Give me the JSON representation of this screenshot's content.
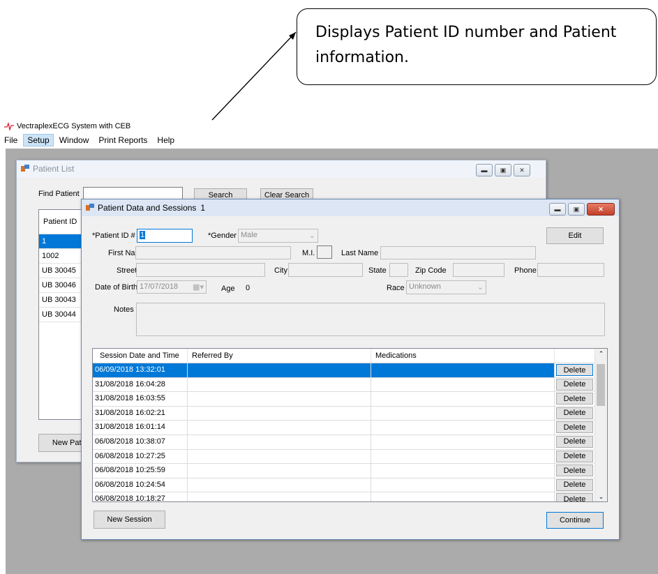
{
  "callout": {
    "text": "Displays Patient ID number and Patient information."
  },
  "app": {
    "title": "VectraplexECG System with CEB"
  },
  "menu": [
    {
      "label": "File"
    },
    {
      "label": "Setup"
    },
    {
      "label": "Window"
    },
    {
      "label": "Print Reports"
    },
    {
      "label": "Help"
    }
  ],
  "patient_list": {
    "title": "Patient List",
    "find_label": "Find Patient",
    "find_value": "",
    "search_label": "Search",
    "clear_label": "Clear Search",
    "column_header": "Patient ID",
    "rows": [
      "1",
      "1002",
      "UB 30045",
      "UB 30046",
      "UB 30043",
      "UB 30044"
    ],
    "new_patient_label": "New Patie"
  },
  "patient_window": {
    "title": "Patient Data and Sessions",
    "title_id": "1",
    "patient_id_label": "*Patient ID #",
    "patient_id_value": "1",
    "gender_label": "*Gender",
    "gender_value": "Male",
    "edit_label": "Edit",
    "first_name_label": "First Name",
    "mi_label": "M.I.",
    "last_name_label": "Last Name",
    "street_label": "Street",
    "city_label": "City",
    "state_label": "State",
    "zip_label": "Zip Code",
    "phone_label": "Phone",
    "dob_label": "Date of Birth",
    "dob_value": "17/07/2018",
    "age_label": "Age",
    "age_value": "0",
    "race_label": "Race",
    "race_value": "Unknown",
    "notes_label": "Notes",
    "grid_headers": [
      "Session Date and Time",
      "Referred By",
      "Medications"
    ],
    "delete_label": "Delete",
    "sessions": [
      "06/09/2018 13:32:01",
      "31/08/2018 16:04:28",
      "31/08/2018 16:03:55",
      "31/08/2018 16:02:21",
      "31/08/2018 16:01:14",
      "06/08/2018 10:38:07",
      "06/08/2018 10:27:25",
      "06/08/2018 10:25:59",
      "06/08/2018 10:24:54",
      "06/08/2018 10:18:27"
    ],
    "new_session_label": "New Session",
    "continue_label": "Continue"
  },
  "colors": {
    "selection": "#0078d7",
    "mdi_background": "#ababab",
    "title_bar": "#dce6f4"
  }
}
